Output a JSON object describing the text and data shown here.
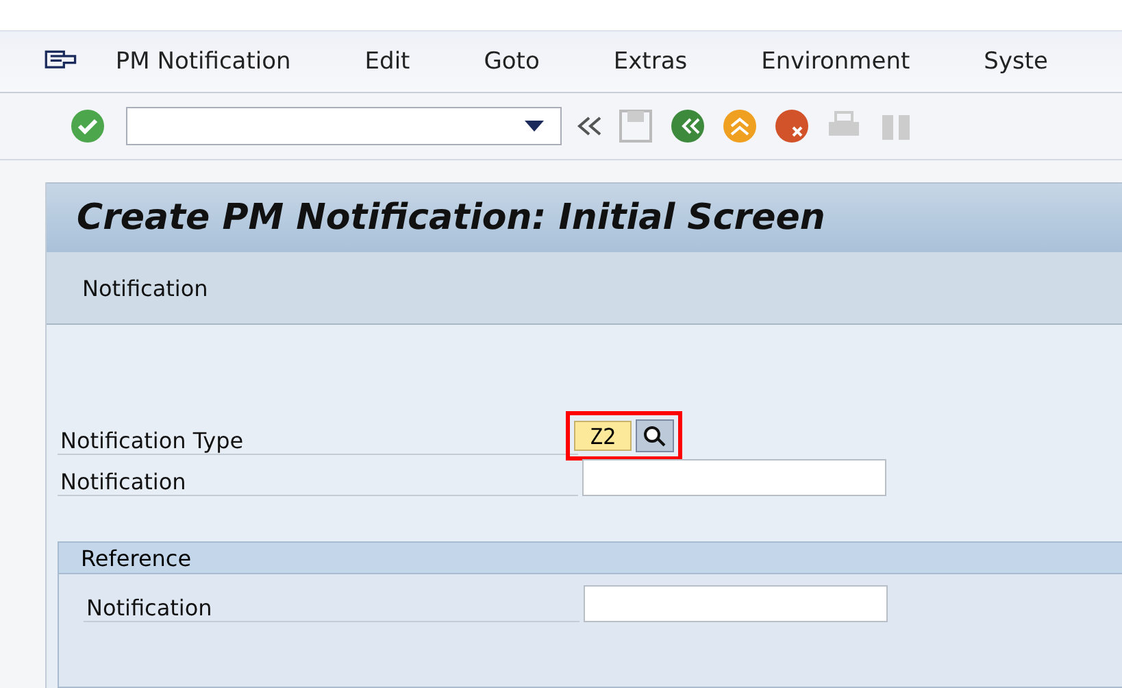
{
  "menu": [
    "PM Notification",
    "Edit",
    "Goto",
    "Extras",
    "Environment",
    "Syste"
  ],
  "screen": {
    "title": "Create PM Notification: Initial Screen",
    "tab": "Notification"
  },
  "fields": [
    {
      "label": "Notification Type",
      "value": "Z2",
      "highlighted": true,
      "kind": "search"
    },
    {
      "label": "Notification",
      "highlighted": false,
      "kind": "plain"
    }
  ],
  "reference": {
    "title": "Reference",
    "fields": [
      {
        "label": "Notification"
      }
    ]
  }
}
